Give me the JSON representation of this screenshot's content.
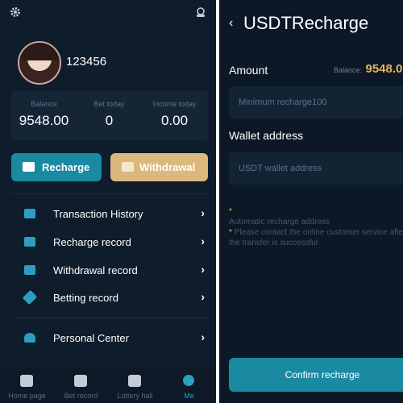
{
  "left": {
    "username": "123456",
    "stats": [
      {
        "label": "Balance",
        "value": "9548.00"
      },
      {
        "label": "Bet today",
        "value": "0"
      },
      {
        "label": "Income today",
        "value": "0.00"
      }
    ],
    "recharge_label": "Recharge",
    "withdrawal_label": "Withdrawal",
    "menu": [
      {
        "label": "Transaction History",
        "icon": "wallet-icon"
      },
      {
        "label": "Recharge record",
        "icon": "wallet-icon"
      },
      {
        "label": "Withdrawal record",
        "icon": "wallet-icon"
      },
      {
        "label": "Betting record",
        "icon": "gavel-icon"
      },
      {
        "label": "Personal Center",
        "icon": "user-edit-icon"
      }
    ],
    "tabs": [
      {
        "label": "Home page",
        "icon": "home-icon"
      },
      {
        "label": "Bet record",
        "icon": "bet-record-icon"
      },
      {
        "label": "Lottery hall",
        "icon": "dice-icon"
      },
      {
        "label": "Me",
        "icon": "user-icon",
        "active": true
      }
    ]
  },
  "right": {
    "back": "‹",
    "title": "USDTRecharge",
    "amount_label": "Amount",
    "balance_label": "Balance:",
    "balance_value": "9548.0",
    "amount_placeholder": "Minimum recharge100",
    "wallet_label": "Wallet address",
    "wallet_placeholder": "USDT wallet address",
    "note_star": "*",
    "note_line1": "Automatic recharge address",
    "note_line2_star": "*",
    "note_line2": " Please contact the online customer service after the transfer is successful",
    "confirm_label": "Confirm recharge"
  },
  "colors": {
    "accent": "#1a8aa3",
    "gold": "#dcb87d",
    "balance_gold": "#e9b45e",
    "background": "#0f1c2b"
  }
}
